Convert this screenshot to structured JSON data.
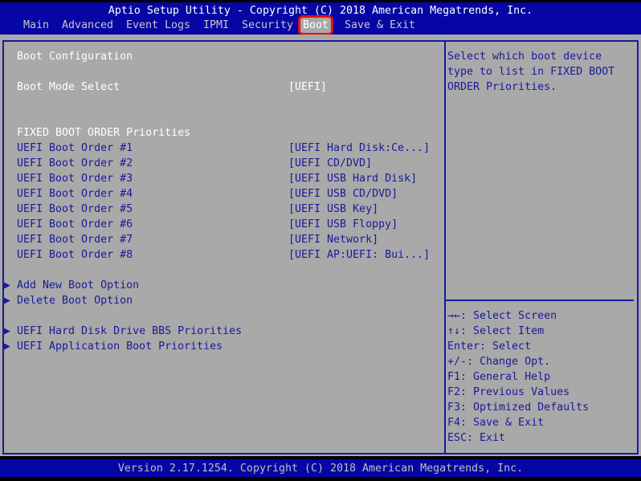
{
  "header": {
    "title": "Aptio Setup Utility - Copyright (C) 2018 American Megatrends, Inc.",
    "tabs": [
      "Main",
      "Advanced",
      "Event Logs",
      "IPMI",
      "Security",
      "Boot",
      "Save & Exit"
    ],
    "active_tab": "Boot"
  },
  "main": {
    "section_title": "Boot Configuration",
    "boot_mode_label": "Boot Mode Select",
    "boot_mode_value": "[UEFI]",
    "fixed_title": "FIXED BOOT ORDER Priorities",
    "boot_orders": [
      {
        "label": "UEFI Boot Order #1",
        "value": "[UEFI Hard Disk:Ce...]"
      },
      {
        "label": "UEFI Boot Order #2",
        "value": "[UEFI CD/DVD]"
      },
      {
        "label": "UEFI Boot Order #3",
        "value": "[UEFI USB Hard Disk]"
      },
      {
        "label": "UEFI Boot Order #4",
        "value": "[UEFI USB CD/DVD]"
      },
      {
        "label": "UEFI Boot Order #5",
        "value": "[UEFI USB Key]"
      },
      {
        "label": "UEFI Boot Order #6",
        "value": "[UEFI USB Floppy]"
      },
      {
        "label": "UEFI Boot Order #7",
        "value": "[UEFI Network]"
      },
      {
        "label": "UEFI Boot Order #8",
        "value": "[UEFI AP:UEFI: Bui...]"
      }
    ],
    "submenus": [
      "Add New Boot Option",
      "Delete Boot Option",
      "UEFI Hard Disk Drive BBS Priorities",
      "UEFI Application Boot Priorities"
    ]
  },
  "help": {
    "description": [
      "Select which boot device",
      "type to list in FIXED BOOT",
      "ORDER Priorities."
    ],
    "keys": [
      "→←: Select Screen",
      "↑↓: Select Item",
      "Enter: Select",
      "+/-: Change Opt.",
      "F1: General Help",
      "F2: Previous Values",
      "F3: Optimized Defaults",
      "F4: Save & Exit",
      "ESC: Exit"
    ]
  },
  "footer": {
    "version": "Version 2.17.1254. Copyright (C) 2018 American Megatrends, Inc."
  }
}
